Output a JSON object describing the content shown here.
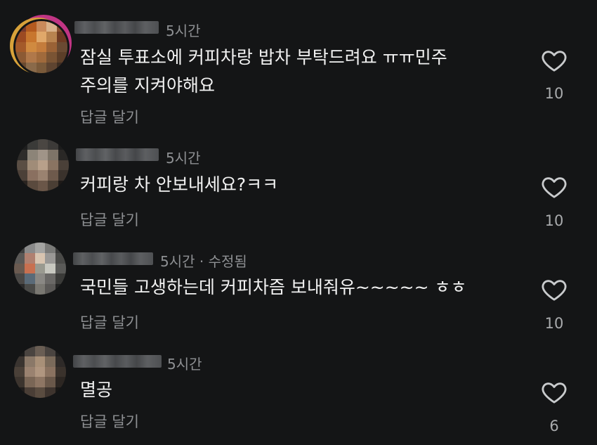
{
  "comments": [
    {
      "time": "5시간",
      "edited": "",
      "text_line1": "잠실 투표소에 커피차랑 밥차 부탁드려요 ㅠㅠ민주",
      "text_line2": "주의를 지켜야해요",
      "reply_label": "답글 달기",
      "likes": "10"
    },
    {
      "time": "5시간",
      "edited": "",
      "text_line1": "커피랑 차 안보내세요?ㅋㅋ",
      "text_line2": "",
      "reply_label": "답글 달기",
      "likes": "10"
    },
    {
      "time": "5시간",
      "edited": " · 수정됨",
      "text_line1": "국민들 고생하는데 커피차즘 보내줘유~~~~~ ㅎㅎ",
      "text_line2": "",
      "reply_label": "답글 달기",
      "likes": "10"
    },
    {
      "time": "5시간",
      "edited": "",
      "text_line1": "멸공",
      "text_line2": "",
      "reply_label": "답글 달기",
      "likes": "6"
    }
  ],
  "colors": {
    "background": "#141516",
    "text": "#f2f2f2",
    "muted": "#8e9093"
  },
  "icons": {
    "like": "heart-outline-icon"
  }
}
